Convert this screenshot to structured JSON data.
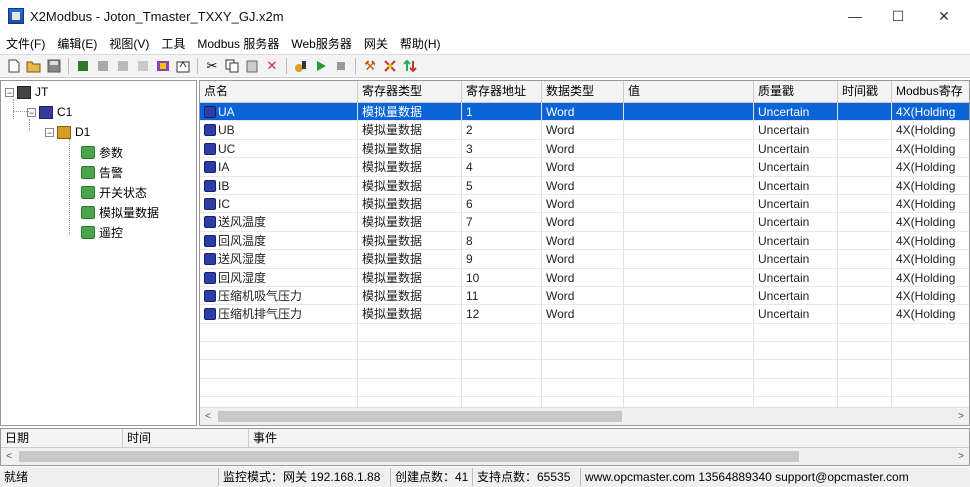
{
  "window": {
    "title": "X2Modbus - Joton_Tmaster_TXXY_GJ.x2m",
    "minimize": "—",
    "maximize": "☐",
    "close": "✕"
  },
  "menu": [
    "文件(F)",
    "编辑(E)",
    "视图(V)",
    "工具",
    "Modbus 服务器",
    "Web服务器",
    "网关",
    "帮助(H)"
  ],
  "toolbar": {
    "icons": [
      "new-icon",
      "open-icon",
      "save-icon",
      "add-channel-icon",
      "add-device-icon",
      "add-group-icon",
      "add-tag-icon",
      "properties-icon",
      "cut-icon",
      "copy-icon",
      "paste-icon",
      "delete-icon",
      "monitor-icon",
      "run-icon",
      "stop-icon",
      "tools-icon",
      "settings-icon",
      "sort-icon"
    ]
  },
  "tree": {
    "root": "JT",
    "channel": "C1",
    "device": "D1",
    "groups": [
      "参数",
      "告警",
      "开关状态",
      "模拟量数据",
      "遥控"
    ],
    "expander_collapse": "−"
  },
  "grid": {
    "columns": [
      "点名",
      "寄存器类型",
      "寄存器地址",
      "数据类型",
      "值",
      "质量戳",
      "时间戳",
      "Modbus寄存"
    ],
    "rows": [
      {
        "name": "UA",
        "reg_type": "模拟量数据",
        "addr": "1",
        "dtype": "Word",
        "value": "",
        "quality": "Uncertain",
        "time": "",
        "modbus": "4X(Holding"
      },
      {
        "name": "UB",
        "reg_type": "模拟量数据",
        "addr": "2",
        "dtype": "Word",
        "value": "",
        "quality": "Uncertain",
        "time": "",
        "modbus": "4X(Holding"
      },
      {
        "name": "UC",
        "reg_type": "模拟量数据",
        "addr": "3",
        "dtype": "Word",
        "value": "",
        "quality": "Uncertain",
        "time": "",
        "modbus": "4X(Holding"
      },
      {
        "name": "IA",
        "reg_type": "模拟量数据",
        "addr": "4",
        "dtype": "Word",
        "value": "",
        "quality": "Uncertain",
        "time": "",
        "modbus": "4X(Holding"
      },
      {
        "name": "IB",
        "reg_type": "模拟量数据",
        "addr": "5",
        "dtype": "Word",
        "value": "",
        "quality": "Uncertain",
        "time": "",
        "modbus": "4X(Holding"
      },
      {
        "name": "IC",
        "reg_type": "模拟量数据",
        "addr": "6",
        "dtype": "Word",
        "value": "",
        "quality": "Uncertain",
        "time": "",
        "modbus": "4X(Holding"
      },
      {
        "name": "送风温度",
        "reg_type": "模拟量数据",
        "addr": "7",
        "dtype": "Word",
        "value": "",
        "quality": "Uncertain",
        "time": "",
        "modbus": "4X(Holding"
      },
      {
        "name": "回风温度",
        "reg_type": "模拟量数据",
        "addr": "8",
        "dtype": "Word",
        "value": "",
        "quality": "Uncertain",
        "time": "",
        "modbus": "4X(Holding"
      },
      {
        "name": "送风湿度",
        "reg_type": "模拟量数据",
        "addr": "9",
        "dtype": "Word",
        "value": "",
        "quality": "Uncertain",
        "time": "",
        "modbus": "4X(Holding"
      },
      {
        "name": "回风湿度",
        "reg_type": "模拟量数据",
        "addr": "10",
        "dtype": "Word",
        "value": "",
        "quality": "Uncertain",
        "time": "",
        "modbus": "4X(Holding"
      },
      {
        "name": "压缩机吸气压力",
        "reg_type": "模拟量数据",
        "addr": "11",
        "dtype": "Word",
        "value": "",
        "quality": "Uncertain",
        "time": "",
        "modbus": "4X(Holding"
      },
      {
        "name": "压缩机排气压力",
        "reg_type": "模拟量数据",
        "addr": "12",
        "dtype": "Word",
        "value": "",
        "quality": "Uncertain",
        "time": "",
        "modbus": "4X(Holding"
      }
    ],
    "empty_rows": 5,
    "scroll_left": "<",
    "scroll_right": ">"
  },
  "log": {
    "columns": [
      "日期",
      "时间",
      "事件"
    ],
    "scroll_left": "<",
    "scroll_right": ">"
  },
  "status": [
    "就绪",
    "监控模式：网关 192.168.1.88",
    "创建点数：41",
    "支持点数：65535",
    "www.opcmaster.com 13564889340 support@opcmaster.com"
  ],
  "colors": {
    "selection": "#0a64d6",
    "point_icon": "#2c3da6"
  }
}
